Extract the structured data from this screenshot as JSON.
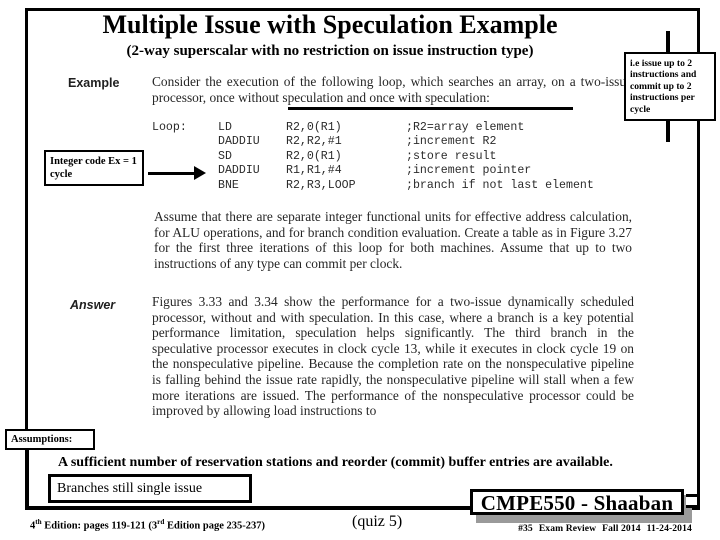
{
  "slide": {
    "title": "Multiple Issue with Speculation Example",
    "subtitle": "(2-way superscalar with no restriction on issue instruction type)"
  },
  "textbook": {
    "example_label": "Example",
    "example_paragraph": "Consider the execution of the following loop, which searches an array, on a two-issue processor, once without speculation and once with speculation:",
    "code": {
      "lines": [
        {
          "label": "Loop:",
          "op": "LD",
          "operands": "R2,0(R1)",
          "comment": ";R2=array element"
        },
        {
          "label": "",
          "op": "DADDIU",
          "operands": "R2,R2,#1",
          "comment": ";increment R2"
        },
        {
          "label": "",
          "op": "SD",
          "operands": "R2,0(R1)",
          "comment": ";store result"
        },
        {
          "label": "",
          "op": "DADDIU",
          "operands": "R1,R1,#4",
          "comment": ";increment pointer"
        },
        {
          "label": "",
          "op": "BNE",
          "operands": "R2,R3,LOOP",
          "comment": ";branch if not last element"
        }
      ]
    },
    "assume_paragraph": "Assume that there are separate integer functional units for effective address calculation, for ALU operations, and for branch condition evaluation. Create a table as in Figure 3.27 for the first three iterations of this loop for both machines. Assume that up to two instructions of any type can commit per clock.",
    "answer_label": "Answer",
    "answer_paragraph": "Figures 3.33 and 3.34 show the performance for a two-issue dynamically scheduled processor, without and with speculation. In this case, where a branch is a key potential performance limitation, speculation helps significantly. The third branch in the speculative processor executes in clock cycle 13, while it executes in clock cycle 19 on the nonspeculative pipeline. Because the completion rate on the nonspeculative pipeline is falling behind the issue rate rapidly, the nonspeculative pipeline will stall when a few more iterations are issued. The performance of the nonspeculative processor could be improved by allowing load instructions to"
  },
  "annotations": {
    "issue_note": "i.e issue up to 2 instructions and commit up to 2 instructions per cycle",
    "integer_note": "Integer code Ex = 1 cycle",
    "assumptions_label": "Assumptions:",
    "sufficient_note": "A sufficient number of reservation stations and reorder (commit) buffer entries are available.",
    "branches_note": "Branches still single issue"
  },
  "footer": {
    "edition_prefix": "4",
    "edition_sup1": "th",
    "edition_mid": " Edition: pages 119-121  (3",
    "edition_sup2": "rd",
    "edition_suffix": " Edition page 235-237)",
    "quiz": "(quiz 5)",
    "banner": "CMPE550 - Shaaban",
    "slide_number": "#35",
    "course_part": "Exam Review",
    "term": "Fall 2014",
    "date": "11-24-2014"
  },
  "colors": {
    "ink": "#000000",
    "scan_ink": "#262626",
    "shadow": "#9a9a9a",
    "background": "#ffffff"
  }
}
